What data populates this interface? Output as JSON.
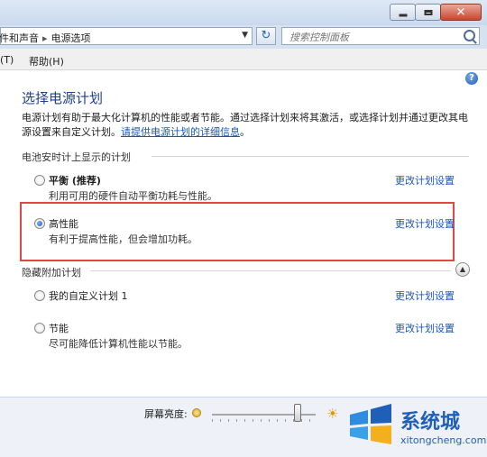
{
  "breadcrumb": {
    "part1": "件和声音",
    "part2": "电源选项"
  },
  "search": {
    "placeholder": "搜索控制面板"
  },
  "menu": {
    "item1": "(T)",
    "item2": "帮助(H)"
  },
  "page": {
    "help": "?",
    "title": "选择电源计划",
    "desc_line1": "电源计划有助于最大化计算机的性能或者节能。通过选择计划来将其激活，或选择计划并通过更改其电",
    "desc_line2_prefix": "源设置来自定义计划。",
    "desc_link": "请提供电源计划的详细信息",
    "desc_line2_suffix": "。"
  },
  "section_battery": "电池安时计上显示的计划",
  "section_hidden": "隐藏附加计划",
  "plans": [
    {
      "name": "平衡 (推荐)",
      "desc": "利用可用的硬件自动平衡功耗与性能。",
      "change": "更改计划设置",
      "selected": false
    },
    {
      "name": "高性能",
      "desc": "有利于提高性能，但会增加功耗。",
      "change": "更改计划设置",
      "selected": true
    },
    {
      "name": "我的自定义计划 1",
      "desc": "",
      "change": "更改计划设置",
      "selected": false
    },
    {
      "name": "节能",
      "desc": "尽可能降低计算机性能以节能。",
      "change": "更改计划设置",
      "selected": false
    }
  ],
  "brightness": {
    "label": "屏幕亮度:",
    "level": 0.83
  },
  "watermark": {
    "cn": "系统城",
    "en": "xitongcheng.com"
  },
  "colors": {
    "highlight": "#e04848",
    "link": "#1a57b5",
    "title": "#1f3f8f"
  }
}
